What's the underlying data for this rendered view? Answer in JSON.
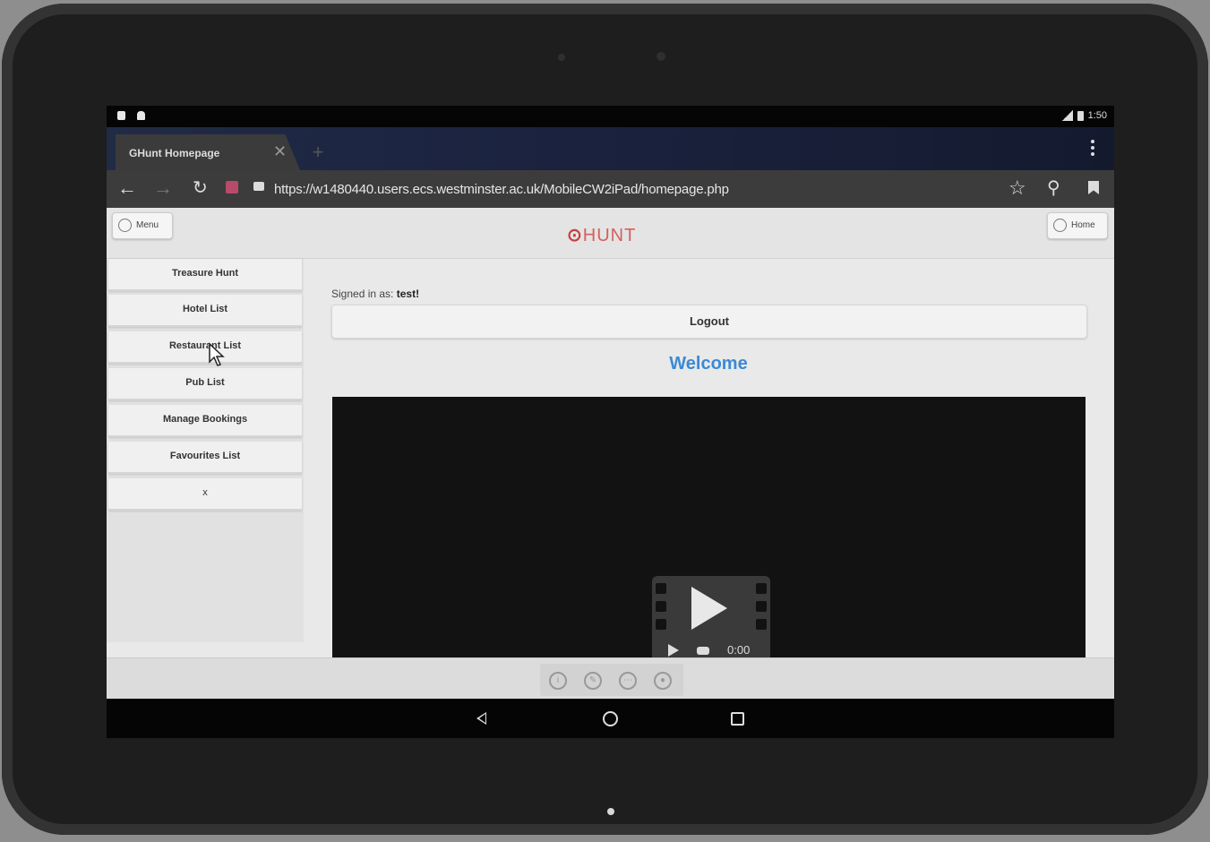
{
  "statusbar": {
    "time": "1:50"
  },
  "browser": {
    "tab_title": "GHunt Homepage",
    "tab_close": "✕",
    "new_tab": "+",
    "url": "https://w1480440.users.ecs.westminster.ac.uk/MobileCW2iPad/homepage.php"
  },
  "header": {
    "menu_label": "Menu",
    "home_label": "Home",
    "logo_text": "HUNT"
  },
  "sidebar": {
    "items": [
      {
        "label": "Treasure Hunt"
      },
      {
        "label": "Hotel List"
      },
      {
        "label": "Restaurant List"
      },
      {
        "label": "Pub List"
      },
      {
        "label": "Manage Bookings"
      },
      {
        "label": "Favourites List"
      },
      {
        "label": "x"
      }
    ]
  },
  "content": {
    "signed_in_prefix": "Signed in as:",
    "username": "test!",
    "logout_label": "Logout",
    "welcome": "Welcome",
    "video_time": "0:00"
  },
  "footer": {
    "icons": [
      "info-icon",
      "edit-icon",
      "chat-icon",
      "user-icon"
    ]
  },
  "colors": {
    "accent": "#3a8ad6",
    "logo": "#c94040"
  }
}
